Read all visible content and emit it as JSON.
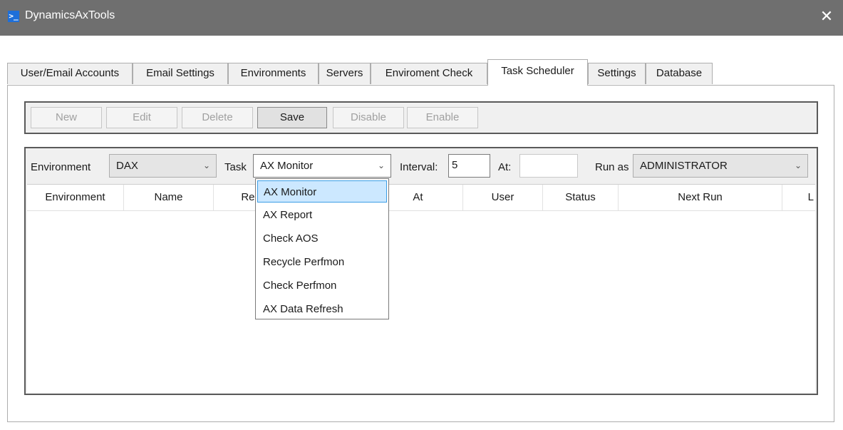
{
  "window": {
    "title": "DynamicsAxTools",
    "icon": "powershell-icon",
    "close_glyph": "✕"
  },
  "tabs": [
    {
      "label": "User/Email Accounts"
    },
    {
      "label": "Email Settings"
    },
    {
      "label": "Environments"
    },
    {
      "label": "Servers"
    },
    {
      "label": "Enviroment Check"
    },
    {
      "label": "Task Scheduler",
      "active": true
    },
    {
      "label": "Settings"
    },
    {
      "label": "Database"
    }
  ],
  "toolbar": {
    "new": "New",
    "edit": "Edit",
    "delete": "Delete",
    "save": "Save",
    "disable": "Disable",
    "enable": "Enable"
  },
  "filters": {
    "environment_label": "Environment",
    "environment_value": "DAX",
    "task_label": "Task",
    "task_value": "AX Monitor",
    "interval_label": "Interval:",
    "interval_value": "5",
    "at_label": "At:",
    "at_value": "",
    "runas_label": "Run as",
    "runas_value": "ADMINISTRATOR"
  },
  "grid": {
    "columns": [
      "Environment",
      "Name",
      "Repeat",
      "",
      "At",
      "User",
      "Status",
      "Next Run",
      "L"
    ]
  },
  "task_dropdown": {
    "options": [
      "AX Monitor",
      "AX Report",
      "Check AOS",
      "Recycle Perfmon",
      "Check Perfmon",
      "AX Data Refresh"
    ],
    "selected": "AX Monitor"
  },
  "colors": {
    "titlebar": "#6f6f6f",
    "selection": "#cce8ff",
    "selection_border": "#3c9ee5"
  }
}
